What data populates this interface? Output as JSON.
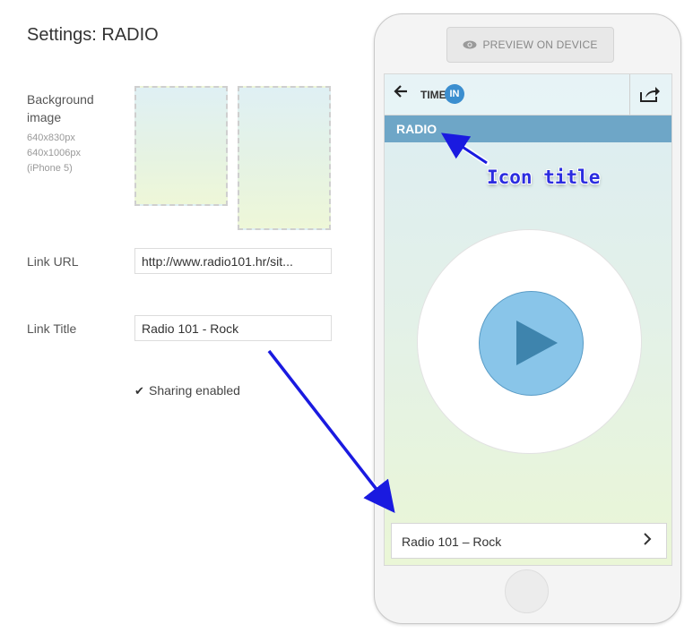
{
  "settings": {
    "title": "Settings: RADIO",
    "background": {
      "label_line1": "Background",
      "label_line2": "image",
      "size1": "640x830px",
      "size2": "640x1006px",
      "size3": "(iPhone 5)"
    },
    "link_url": {
      "label": "Link URL",
      "value": "http://www.radio101.hr/sit..."
    },
    "link_title": {
      "label": "Link Title",
      "value": "Radio 101 - Rock"
    },
    "sharing": {
      "label": "Sharing enabled"
    }
  },
  "preview": {
    "button_label": "PREVIEW ON DEVICE",
    "logo_text": "TIME",
    "logo_badge": "IN",
    "screen_title": "RADIO",
    "link_row_text": "Radio 101 – Rock",
    "annotation_label": "Icon title"
  },
  "colors": {
    "title_bar": "#6ea6c7",
    "play_fill": "#89c5e9",
    "play_triangle": "#3e84ad",
    "arrow": "#1a1ae0"
  }
}
